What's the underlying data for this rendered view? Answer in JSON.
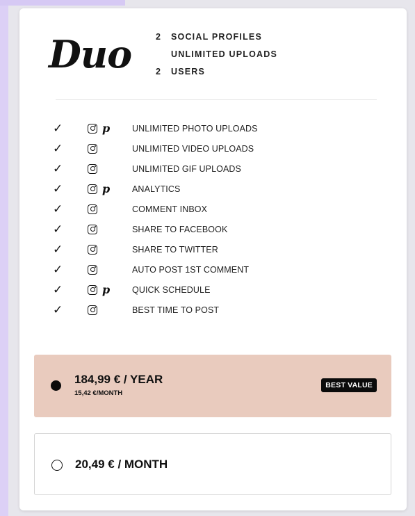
{
  "plan": {
    "name": "Duo",
    "lines": [
      {
        "count": "2",
        "text": "SOCIAL PROFILES"
      },
      {
        "count": "",
        "text": "UNLIMITED UPLOADS"
      },
      {
        "count": "2",
        "text": "USERS"
      }
    ]
  },
  "features": [
    {
      "label": "UNLIMITED PHOTO UPLOADS",
      "icons": [
        "instagram-icon",
        "pinterest-icon"
      ]
    },
    {
      "label": "UNLIMITED VIDEO UPLOADS",
      "icons": [
        "instagram-icon"
      ]
    },
    {
      "label": "UNLIMITED GIF UPLOADS",
      "icons": [
        "instagram-icon"
      ]
    },
    {
      "label": "ANALYTICS",
      "icons": [
        "instagram-icon",
        "pinterest-icon"
      ]
    },
    {
      "label": "COMMENT INBOX",
      "icons": [
        "instagram-icon"
      ]
    },
    {
      "label": "SHARE TO FACEBOOK",
      "icons": [
        "instagram-icon"
      ]
    },
    {
      "label": "SHARE TO TWITTER",
      "icons": [
        "instagram-icon"
      ]
    },
    {
      "label": "AUTO POST 1ST COMMENT",
      "icons": [
        "instagram-icon"
      ]
    },
    {
      "label": "QUICK SCHEDULE",
      "icons": [
        "instagram-icon",
        "pinterest-icon"
      ]
    },
    {
      "label": "BEST TIME TO POST",
      "icons": [
        "instagram-icon"
      ]
    }
  ],
  "options": {
    "yearly": {
      "price": "184,99 € / YEAR",
      "per_month": "15,42 €/MONTH",
      "badge": "BEST VALUE",
      "selected": true,
      "background": "#e9cbbe"
    },
    "monthly": {
      "price": "20,49 € / MONTH",
      "selected": false
    }
  }
}
